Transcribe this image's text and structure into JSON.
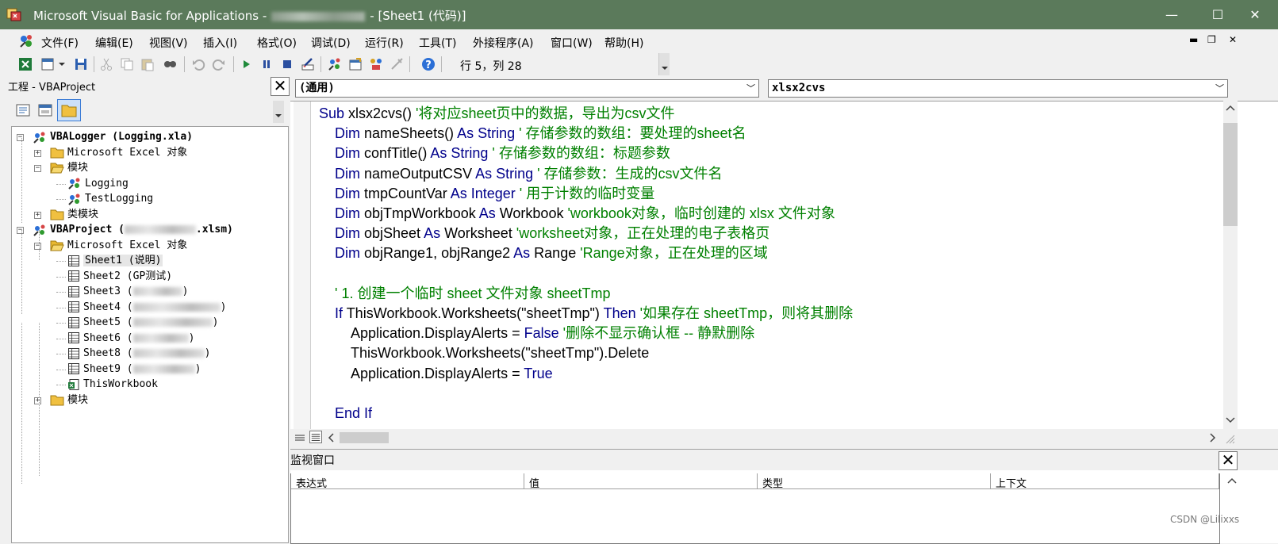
{
  "window": {
    "title_prefix": "Microsoft Visual Basic for Applications -",
    "title_suffix": "- [Sheet1 (代码)]",
    "minimize": "—",
    "maximize": "☐",
    "close": "✕"
  },
  "menu": {
    "items": [
      "文件(F)",
      "编辑(E)",
      "视图(V)",
      "插入(I)",
      "格式(O)",
      "调试(D)",
      "运行(R)",
      "工具(T)",
      "外接程序(A)",
      "窗口(W)",
      "帮助(H)"
    ],
    "mdi_min": "▬",
    "mdi_restore": "❐",
    "mdi_close": "✕"
  },
  "toolbar": {
    "position_label": "行 5，列 28",
    "icons": [
      "excel-icon",
      "insert-module-icon",
      "dropdown-icon",
      "save-icon",
      "cut-icon",
      "copy-icon",
      "paste-icon",
      "find-icon",
      "undo-icon",
      "redo-icon",
      "run-icon",
      "break-icon",
      "reset-icon",
      "design-mode-icon",
      "project-explorer-icon",
      "properties-icon",
      "object-browser-icon",
      "toolbox-icon",
      "help-icon"
    ]
  },
  "project": {
    "title": "工程 - VBAProject",
    "close": "✕",
    "tree": [
      {
        "label": "VBALogger (Logging.xla)",
        "bold": true
      },
      {
        "label": "Microsoft Excel 对象",
        "bold": false
      },
      {
        "label": "模块",
        "bold": false
      },
      {
        "label": "Logging",
        "bold": false
      },
      {
        "label": "TestLogging",
        "bold": false
      },
      {
        "label": "类模块",
        "bold": false
      },
      {
        "label_a": "VBAProject (",
        "label_b": ".xlsm)",
        "bold": true
      },
      {
        "label": "Microsoft Excel 对象",
        "bold": false
      },
      {
        "label": "Sheet1 (说明)",
        "bold": false
      },
      {
        "label": "Sheet2 (GP测试)",
        "bold": false
      },
      {
        "label_a": "Sheet3 (",
        "label_b": ")",
        "bold": false
      },
      {
        "label_a": "Sheet4 (",
        "label_b": ")",
        "bold": false
      },
      {
        "label_a": "Sheet5 (",
        "label_b": ")",
        "bold": false
      },
      {
        "label_a": "Sheet6 (",
        "label_b": ")",
        "bold": false
      },
      {
        "label_a": "Sheet8 (",
        "label_b": ")",
        "bold": false
      },
      {
        "label_a": "Sheet9 (",
        "label_b": ")",
        "bold": false
      },
      {
        "label": "ThisWorkbook",
        "bold": false
      },
      {
        "label": "模块",
        "bold": false
      }
    ]
  },
  "code": {
    "object_combo": "(通用)",
    "procedure_combo": "xlsx2cvs",
    "lines": [
      [
        [
          "kw",
          "Sub "
        ],
        [
          "tx",
          "xlsx2cvs() "
        ],
        [
          "cm",
          "'将对应sheet页中的数据，导出为csv文件"
        ]
      ],
      [
        [
          "kw",
          "Dim "
        ],
        [
          "tx",
          "nameSheets() "
        ],
        [
          "kw",
          "As String "
        ],
        [
          "cm",
          "' 存储参数的数组：要处理的sheet名"
        ]
      ],
      [
        [
          "kw",
          "Dim "
        ],
        [
          "tx",
          "confTitle() "
        ],
        [
          "kw",
          "As String "
        ],
        [
          "cm",
          "' 存储参数的数组：标题参数"
        ]
      ],
      [
        [
          "kw",
          "Dim "
        ],
        [
          "tx",
          "nameOutputCSV "
        ],
        [
          "kw",
          "As String "
        ],
        [
          "cm",
          "' 存储参数：生成的csv文件名"
        ]
      ],
      [
        [
          "kw",
          "Dim "
        ],
        [
          "tx",
          "tmpCountVar "
        ],
        [
          "kw",
          "As Integer "
        ],
        [
          "cm",
          "' 用于计数的临时变量"
        ]
      ],
      [
        [
          "kw",
          "Dim "
        ],
        [
          "tx",
          "objTmpWorkbook "
        ],
        [
          "kw",
          "As "
        ],
        [
          "tx",
          "Workbook "
        ],
        [
          "cm",
          "'workbook对象，临时创建的 xlsx 文件对象"
        ]
      ],
      [
        [
          "kw",
          "Dim "
        ],
        [
          "tx",
          "objSheet "
        ],
        [
          "kw",
          "As "
        ],
        [
          "tx",
          "Worksheet "
        ],
        [
          "cm",
          "'worksheet对象，正在处理的电子表格页"
        ]
      ],
      [
        [
          "kw",
          "Dim "
        ],
        [
          "tx",
          "objRange1, objRange2 "
        ],
        [
          "kw",
          "As "
        ],
        [
          "tx",
          "Range "
        ],
        [
          "cm",
          "'Range对象，正在处理的区域"
        ]
      ],
      [],
      [
        [
          "cm",
          "' 1. 创建一个临时 sheet 文件对象 sheetTmp"
        ]
      ],
      [
        [
          "kw",
          "If "
        ],
        [
          "tx",
          "ThisWorkbook.Worksheets(\"sheetTmp\") "
        ],
        [
          "kw",
          "Then "
        ],
        [
          "cm",
          "'如果存在 sheetTmp，则将其删除"
        ]
      ],
      [
        [
          "tx",
          "Application.DisplayAlerts = "
        ],
        [
          "kw",
          "False "
        ],
        [
          "cm",
          "'删除不显示确认框 -- 静默删除"
        ]
      ],
      [
        [
          "tx",
          "ThisWorkbook.Worksheets(\"sheetTmp\").Delete"
        ]
      ],
      [
        [
          "tx",
          "Application.DisplayAlerts = "
        ],
        [
          "kw",
          "True"
        ]
      ],
      [],
      [
        [
          "kw",
          "End If"
        ]
      ]
    ]
  },
  "watch": {
    "title": "监视窗口",
    "close": "✕",
    "columns": [
      "表达式",
      "值",
      "类型",
      "上下文"
    ]
  },
  "watermark": "CSDN @Lilixxs"
}
